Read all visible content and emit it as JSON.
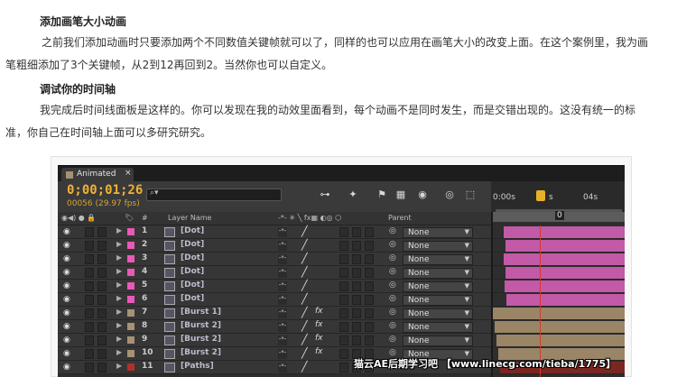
{
  "article": {
    "heading1": "添加画笔大小动画",
    "para1_line1": "之前我们添加动画时只要添加两个不同数值关键帧就可以了，同样的也可以应用在画笔大小的改变上面。在这个案例里，我为画",
    "para1_line2": "笔粗细添加了3个关键帧，从2到12再回到2。当然你也可以自定义。",
    "heading2": "调试你的时间轴",
    "para2_line1": "我完成后时间线面板是这样的。你可以发现在我的动效里面看到，每个动画不是同时发生，而是交错出现的。这没有统一的标",
    "para2_line2": "准，你自己在时间轴上面可以多研究研究。"
  },
  "panel": {
    "tab_label": "Animated",
    "tab_close": "×",
    "timecode": "0;00;01;26",
    "frames": "00056 (29.97 fps)",
    "search_icon": "search-icon",
    "ruler_labels": [
      "0:00s",
      "s",
      "04s"
    ],
    "work_value": "0",
    "headers": {
      "switches_left": "◉◀) ● 🔒",
      "label": "🏷",
      "num": "#",
      "layer_name": "Layer Name",
      "switches_mid": "-*- ✳ ╲ fx▦ ◐◎ ⬡",
      "parent": "Parent"
    },
    "colors": {
      "pink": "#e85ab8",
      "tan": "#a89272",
      "red": "#b0302b",
      "pink_bar": "#c25aa7",
      "tan_bar": "#9a8567",
      "timecode": "#f2b233",
      "playhead": "#d23b2b"
    },
    "layers": [
      {
        "num": "1",
        "name": "[Dot]",
        "label_color": "#e85ab8",
        "fx": "",
        "parent": "None"
      },
      {
        "num": "2",
        "name": "[Dot]",
        "label_color": "#e85ab8",
        "fx": "",
        "parent": "None"
      },
      {
        "num": "3",
        "name": "[Dot]",
        "label_color": "#e85ab8",
        "fx": "",
        "parent": "None"
      },
      {
        "num": "4",
        "name": "[Dot]",
        "label_color": "#e85ab8",
        "fx": "",
        "parent": "None"
      },
      {
        "num": "5",
        "name": "[Dot]",
        "label_color": "#e85ab8",
        "fx": "",
        "parent": "None"
      },
      {
        "num": "6",
        "name": "[Dot]",
        "label_color": "#e85ab8",
        "fx": "",
        "parent": "None"
      },
      {
        "num": "7",
        "name": "[Burst 1]",
        "label_color": "#a89272",
        "fx": "fx",
        "parent": "None"
      },
      {
        "num": "8",
        "name": "[Burst 2]",
        "label_color": "#a89272",
        "fx": "fx",
        "parent": "None"
      },
      {
        "num": "9",
        "name": "[Burst 2]",
        "label_color": "#a89272",
        "fx": "fx",
        "parent": "None"
      },
      {
        "num": "10",
        "name": "[Burst 2]",
        "label_color": "#a89272",
        "fx": "fx",
        "parent": "None"
      },
      {
        "num": "11",
        "name": "[Paths]",
        "label_color": "#b0302b",
        "fx": "",
        "parent": ""
      }
    ]
  },
  "watermark": "猫云AE后期学习吧 【www.linecg.com/tieba/1775】"
}
